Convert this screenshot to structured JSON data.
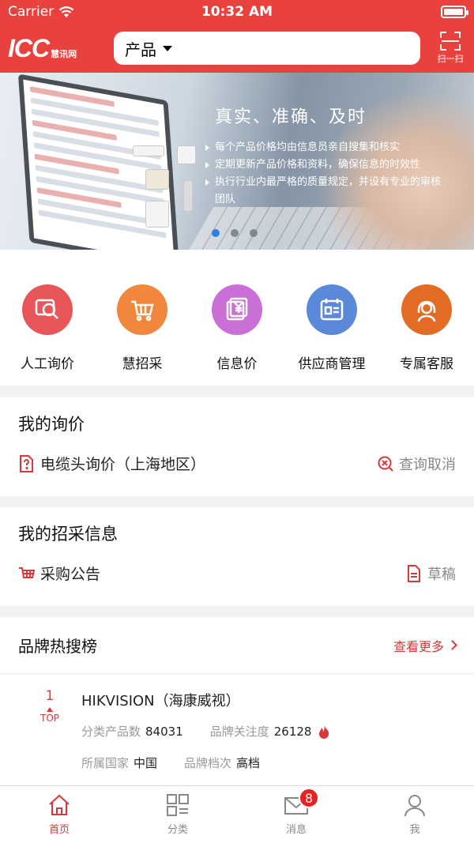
{
  "status_bar": {
    "carrier": "Carrier",
    "time": "10:32 AM"
  },
  "header": {
    "logo_text": "ICC",
    "logo_sub": "慧讯网",
    "search_category": "产品",
    "scan_label": "扫一扫",
    "brand_color": "#e8413e"
  },
  "banner": {
    "title": "真实、准确、及时",
    "bullets": [
      "每个产品价格均由信息员亲自搜集和核实",
      "定期更新产品价格和资料，确保信息的时效性",
      "执行行业内最严格的质量规定，并设有专业的审核团队"
    ],
    "page_count": 3,
    "current_page": 1
  },
  "quick_actions": [
    {
      "label": "人工询价",
      "icon": "inquiry-magnifier-icon",
      "color": "#e9565a"
    },
    {
      "label": "慧招采",
      "icon": "shopping-basket-icon",
      "color": "#f0873d"
    },
    {
      "label": "信息价",
      "icon": "price-document-icon",
      "color": "#c96fd6"
    },
    {
      "label": "供应商管理",
      "icon": "calendar-card-icon",
      "color": "#5b88d9"
    },
    {
      "label": "专属客服",
      "icon": "headset-agent-icon",
      "color": "#e26c24"
    }
  ],
  "my_inquiry": {
    "title": "我的询价",
    "item": "电缆头询价（上海地区）",
    "action": "查询取消"
  },
  "my_procurement": {
    "title": "我的招采信息",
    "item": "采购公告",
    "action": "草稿"
  },
  "hot_brands": {
    "title": "品牌热搜榜",
    "more": "查看更多",
    "items": [
      {
        "rank": "1",
        "rank_tag": "TOP",
        "name": "HIKVISION（海康威视）",
        "product_count_label": "分类产品数",
        "product_count": "84031",
        "attention_label": "品牌关注度",
        "attention": "26128",
        "country_label": "所属国家",
        "country": "中国",
        "grade_label": "品牌档次",
        "grade": "高档"
      }
    ]
  },
  "tabbar": {
    "tabs": [
      {
        "label": "首页",
        "icon": "home-icon",
        "active": true
      },
      {
        "label": "分类",
        "icon": "category-grid-icon",
        "active": false
      },
      {
        "label": "消息",
        "icon": "mail-icon",
        "active": false,
        "badge": "8"
      },
      {
        "label": "我",
        "icon": "user-icon",
        "active": false
      }
    ],
    "active_color": "#d7393a"
  }
}
